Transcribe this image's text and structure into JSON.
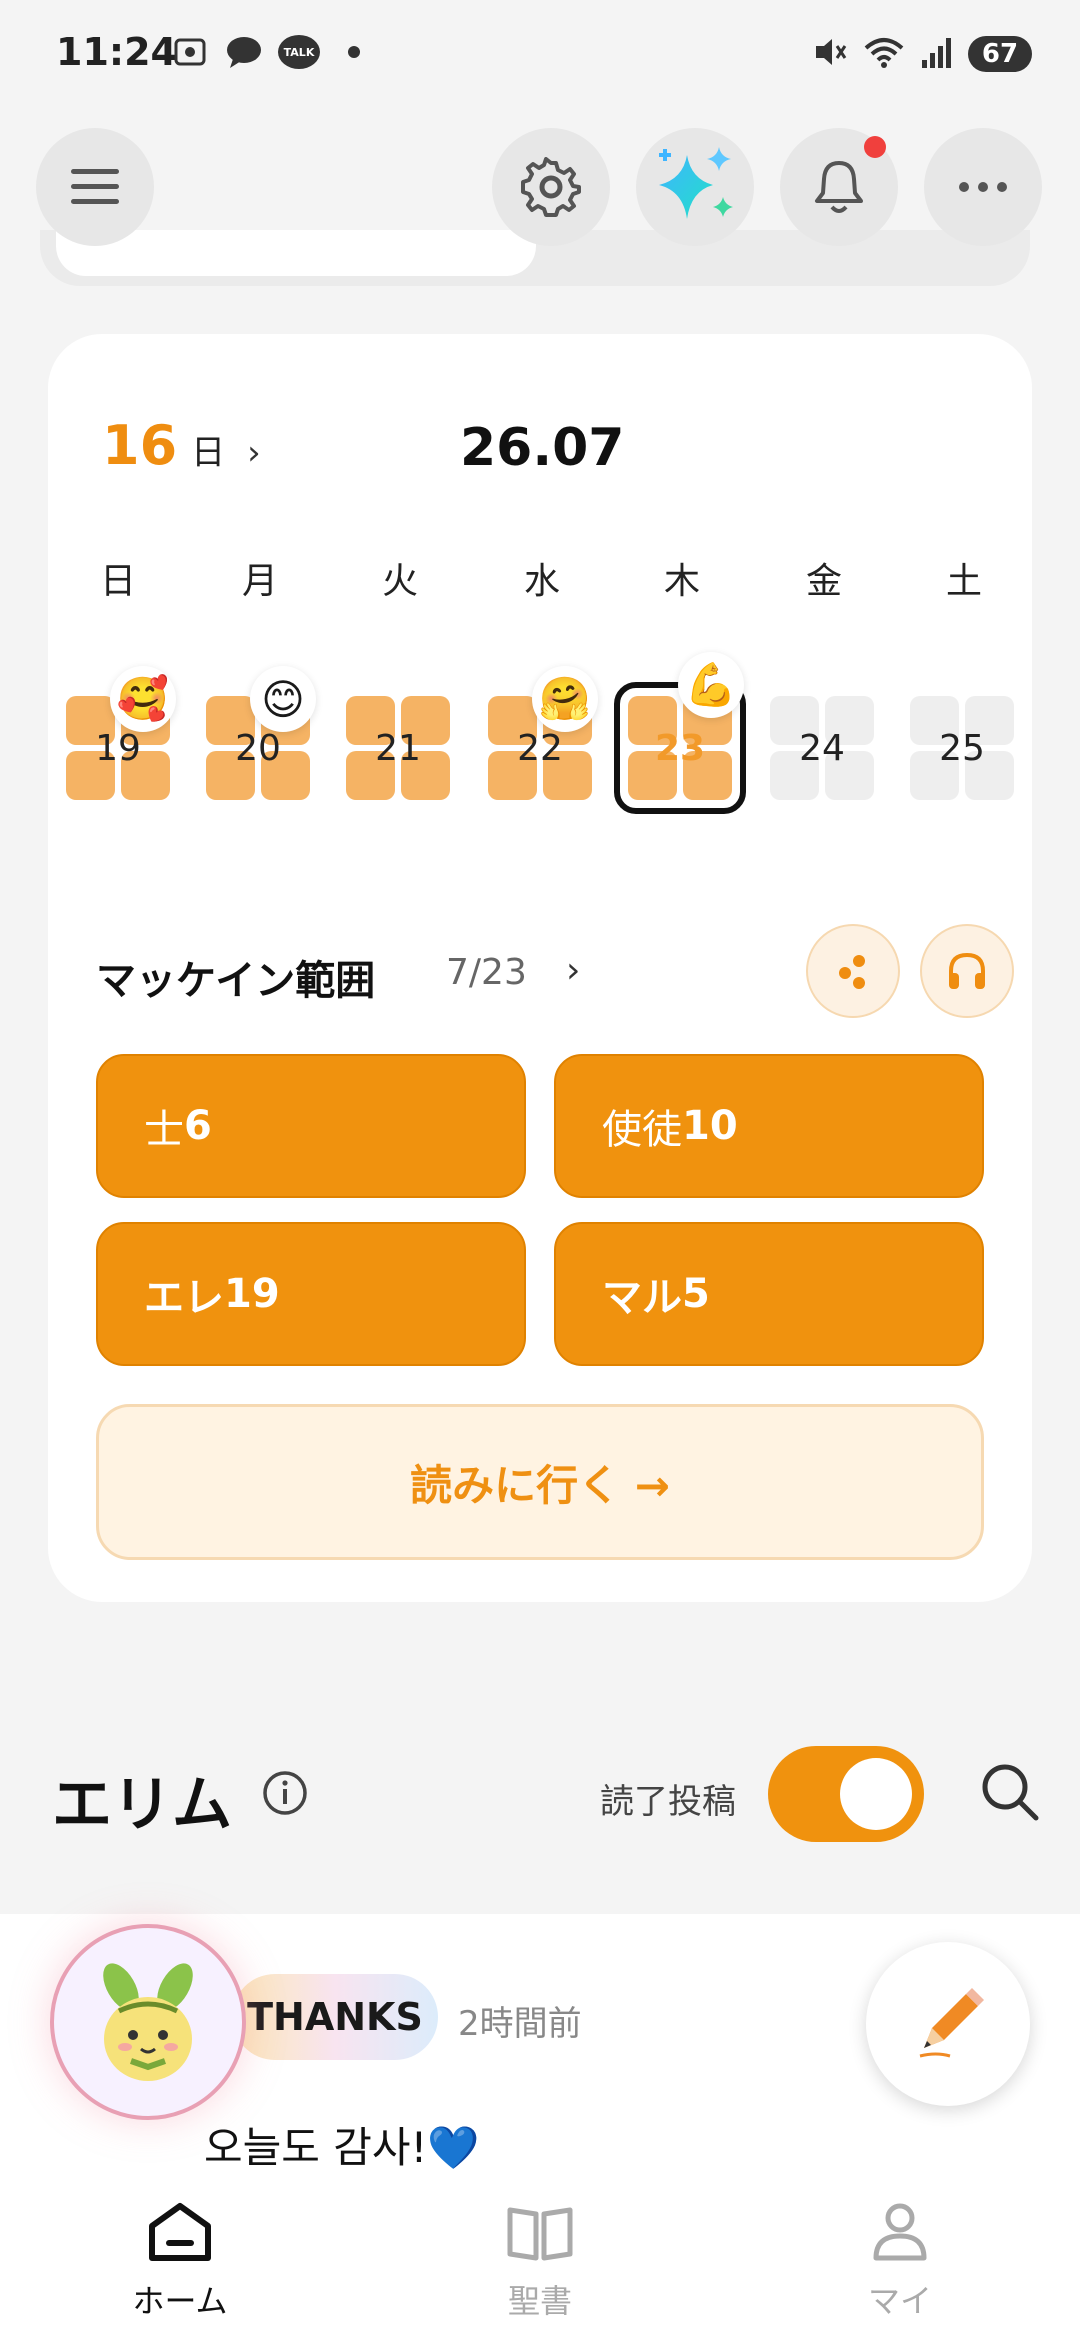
{
  "status_bar": {
    "time": "11:24",
    "battery": "67",
    "talk_label": "TALK"
  },
  "top_bar": {
    "menu_icon": "hamburger-menu-icon",
    "settings_icon": "gear-icon",
    "ai_icon": "sparkle-icon",
    "notification_icon": "bell-icon",
    "more_icon": "more-dots-icon",
    "has_notification": true
  },
  "calendar": {
    "streak_count": "16",
    "streak_unit": "日",
    "streak_arrow": "›",
    "date_title": "26.07",
    "weekdays": [
      "日",
      "月",
      "火",
      "水",
      "木",
      "金",
      "土"
    ],
    "days": [
      {
        "num": "19",
        "emoji": "🥰",
        "status": "done"
      },
      {
        "num": "20",
        "emoji": "😊",
        "status": "done"
      },
      {
        "num": "21",
        "emoji": "",
        "status": "done"
      },
      {
        "num": "22",
        "emoji": "🤗",
        "status": "done"
      },
      {
        "num": "23",
        "emoji": "💪",
        "status": "today"
      },
      {
        "num": "24",
        "emoji": "",
        "status": "empty"
      },
      {
        "num": "25",
        "emoji": "",
        "status": "empty"
      }
    ]
  },
  "reading_range": {
    "title": "マッケイン範囲",
    "date": "7/23",
    "arrow": "›",
    "share_icon": "share-dots-icon",
    "audio_icon": "headphones-icon",
    "chips": [
      {
        "prefix": "士",
        "number": "6"
      },
      {
        "prefix": "使徒",
        "number": "10"
      },
      {
        "prefix": "エレ",
        "number": "19"
      },
      {
        "prefix": "マル",
        "number": "5"
      }
    ],
    "go_button": "読みに行く →"
  },
  "community": {
    "title": "エリム",
    "toggle_label": "読了投稿",
    "toggle_on": true
  },
  "post": {
    "badge": "THANKS",
    "time": "2時間前",
    "text": "오늘도 감사!💙"
  },
  "bottom_nav": {
    "items": [
      {
        "label": "ホーム",
        "icon": "home-icon",
        "active": true
      },
      {
        "label": "聖書",
        "icon": "book-icon",
        "active": false
      },
      {
        "label": "マイ",
        "icon": "person-icon",
        "active": false
      }
    ]
  },
  "colors": {
    "accent": "#f0920e",
    "accent_light": "#f5b364",
    "notification": "#f0403d"
  }
}
